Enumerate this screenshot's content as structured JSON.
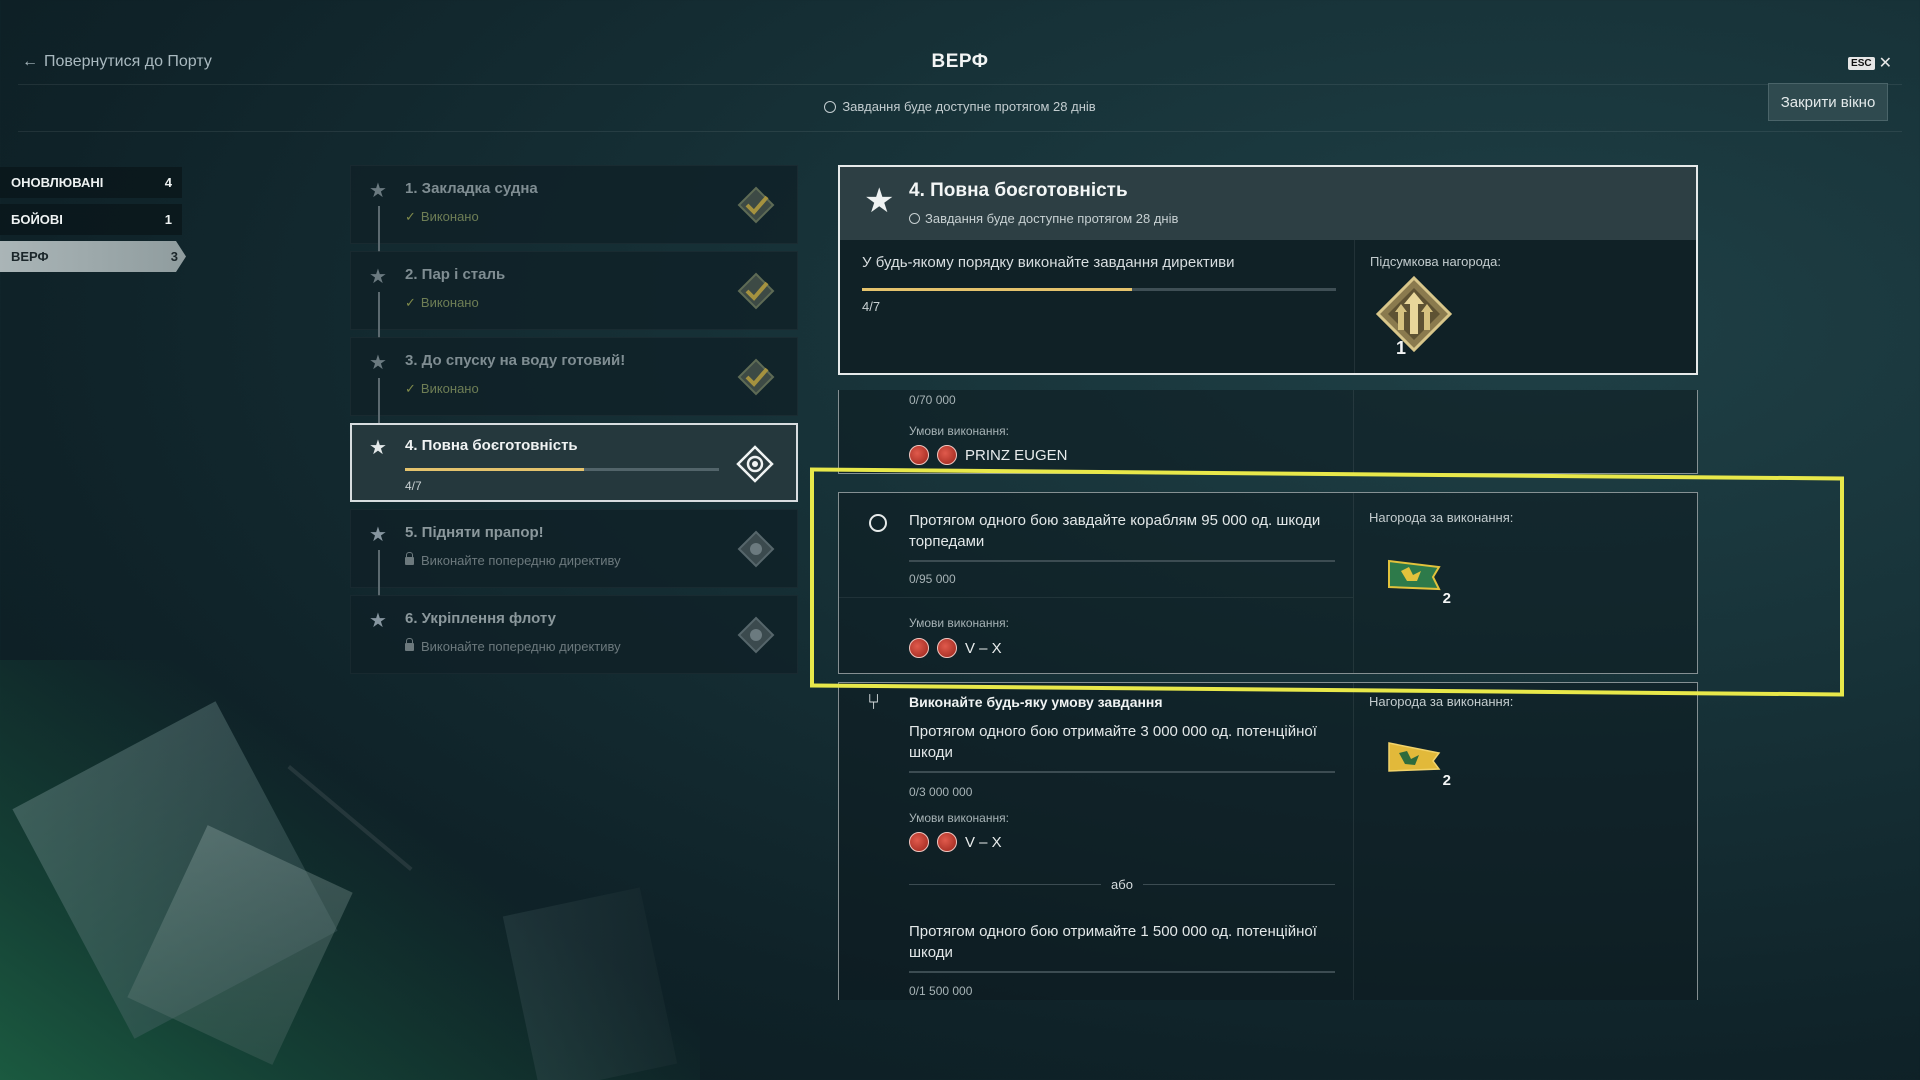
{
  "header": {
    "back_label": "Повернутися до Порту",
    "title": "ВЕРФ",
    "availability": "Завдання буде доступне протягом 28 днів",
    "esc_key": "ESC",
    "close_label": "Закрити вікно"
  },
  "categories": [
    {
      "label": "ОНОВЛЮВАНІ",
      "count": "4"
    },
    {
      "label": "БОЙОВІ",
      "count": "1"
    },
    {
      "label": "ВЕРФ",
      "count": "3"
    }
  ],
  "tasks": [
    {
      "name": "1. Закладка судна",
      "status": "Виконано",
      "state": "done"
    },
    {
      "name": "2. Пар і сталь",
      "status": "Виконано",
      "state": "done"
    },
    {
      "name": "3. До спуску на воду готовий!",
      "status": "Виконано",
      "state": "done"
    },
    {
      "name": "4. Повна боєготовність",
      "progress": "4/7",
      "progress_fraction": 0.57,
      "state": "active"
    },
    {
      "name": "5. Підняти прапор!",
      "status": "Виконайте попередню директиву",
      "state": "locked"
    },
    {
      "name": "6. Укріплення флоту",
      "status": "Виконайте попередню директиву",
      "state": "locked"
    }
  ],
  "detail": {
    "title": "4. Повна боєготовність",
    "availability": "Завдання буде доступне протягом 28 днів",
    "description": "У будь-якому порядку виконайте завдання директиви",
    "progress": "4/7",
    "progress_fraction": 0.57,
    "final_reward_label": "Підсумкова нагорода:",
    "final_reward_count": "1"
  },
  "conditions": {
    "partial": {
      "counter": "0/70 000",
      "cond_label": "Умови виконання:",
      "ship": "PRINZ EUGEN"
    },
    "torpedo": {
      "text": "Протягом одного бою завдайте кораблям 95 000 од. шкоди торпедами",
      "counter": "0/95 000",
      "cond_label": "Умови виконання:",
      "tiers": "V – X",
      "reward_label": "Нагорода за виконання:",
      "reward_count": "2"
    },
    "potential": {
      "heading": "Виконайте будь-яку умову завдання",
      "text1": "Протягом одного бою отримайте 3 000 000 од. потенційної шкоди",
      "counter1": "0/3 000 000",
      "cond_label": "Умови виконання:",
      "tiers": "V – X",
      "or_label": "або",
      "text2": "Протягом одного бою отримайте 1 500 000 од. потенційної шкоди",
      "counter2": "0/1 500 000",
      "reward_label": "Нагорода за виконання:",
      "reward_count": "2"
    }
  },
  "colors": {
    "accent_progress": "#e5c36d",
    "highlight": "#e8e84a",
    "done_check": "#7f8a4a"
  }
}
